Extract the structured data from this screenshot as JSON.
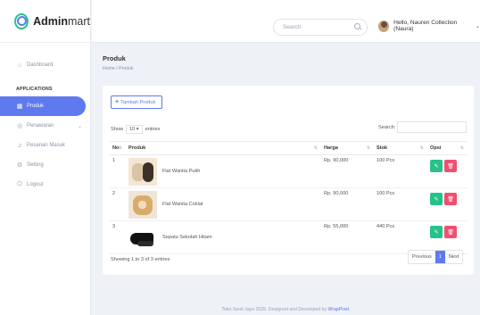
{
  "brand": {
    "name_bold": "Admin",
    "name_rest": "mart"
  },
  "topbar": {
    "search_placeholder": "Search",
    "user_name": "Hello, Nauren Collection (Naura)"
  },
  "sidebar": {
    "dashboard": "Dashboard",
    "section": "APPLICATIONS",
    "items": [
      {
        "label": "Produk"
      },
      {
        "label": "Penawaran"
      },
      {
        "label": "Pesanan Masuk"
      },
      {
        "label": "Setting"
      },
      {
        "label": "Logout"
      }
    ]
  },
  "page": {
    "title": "Produk",
    "breadcrumb": "Home / Produk"
  },
  "card": {
    "add_button": "Tambah Produk",
    "show_prefix": "Show",
    "show_value": "10",
    "show_suffix": "entries",
    "search_label": "Search:",
    "columns": [
      "No",
      "Produk",
      "Harga",
      "Stok",
      "Opsi"
    ],
    "rows": [
      {
        "no": "1",
        "name": "Flat Wanita Putih",
        "price": "Rp. 90,000",
        "stock": "100 Pcs"
      },
      {
        "no": "2",
        "name": "Flat Wanita Coklat",
        "price": "Rp. 90,000",
        "stock": "100 Pcs"
      },
      {
        "no": "3",
        "name": "Sepatu Sekolah Hitam",
        "price": "Rp. 55,000",
        "stock": "440 Pcs"
      }
    ],
    "showing": "Showing 1 to 3 of 3 entries",
    "pager": {
      "prev": "Previous",
      "page": "1",
      "next": "Next"
    }
  },
  "footer": {
    "text": "Toko Seoti Jaya 2025. Designed and Developed by ",
    "link": "WrapPixel"
  },
  "colors": {
    "accent": "#5f79ee",
    "edit": "#27c28a",
    "delete": "#f0506e"
  }
}
